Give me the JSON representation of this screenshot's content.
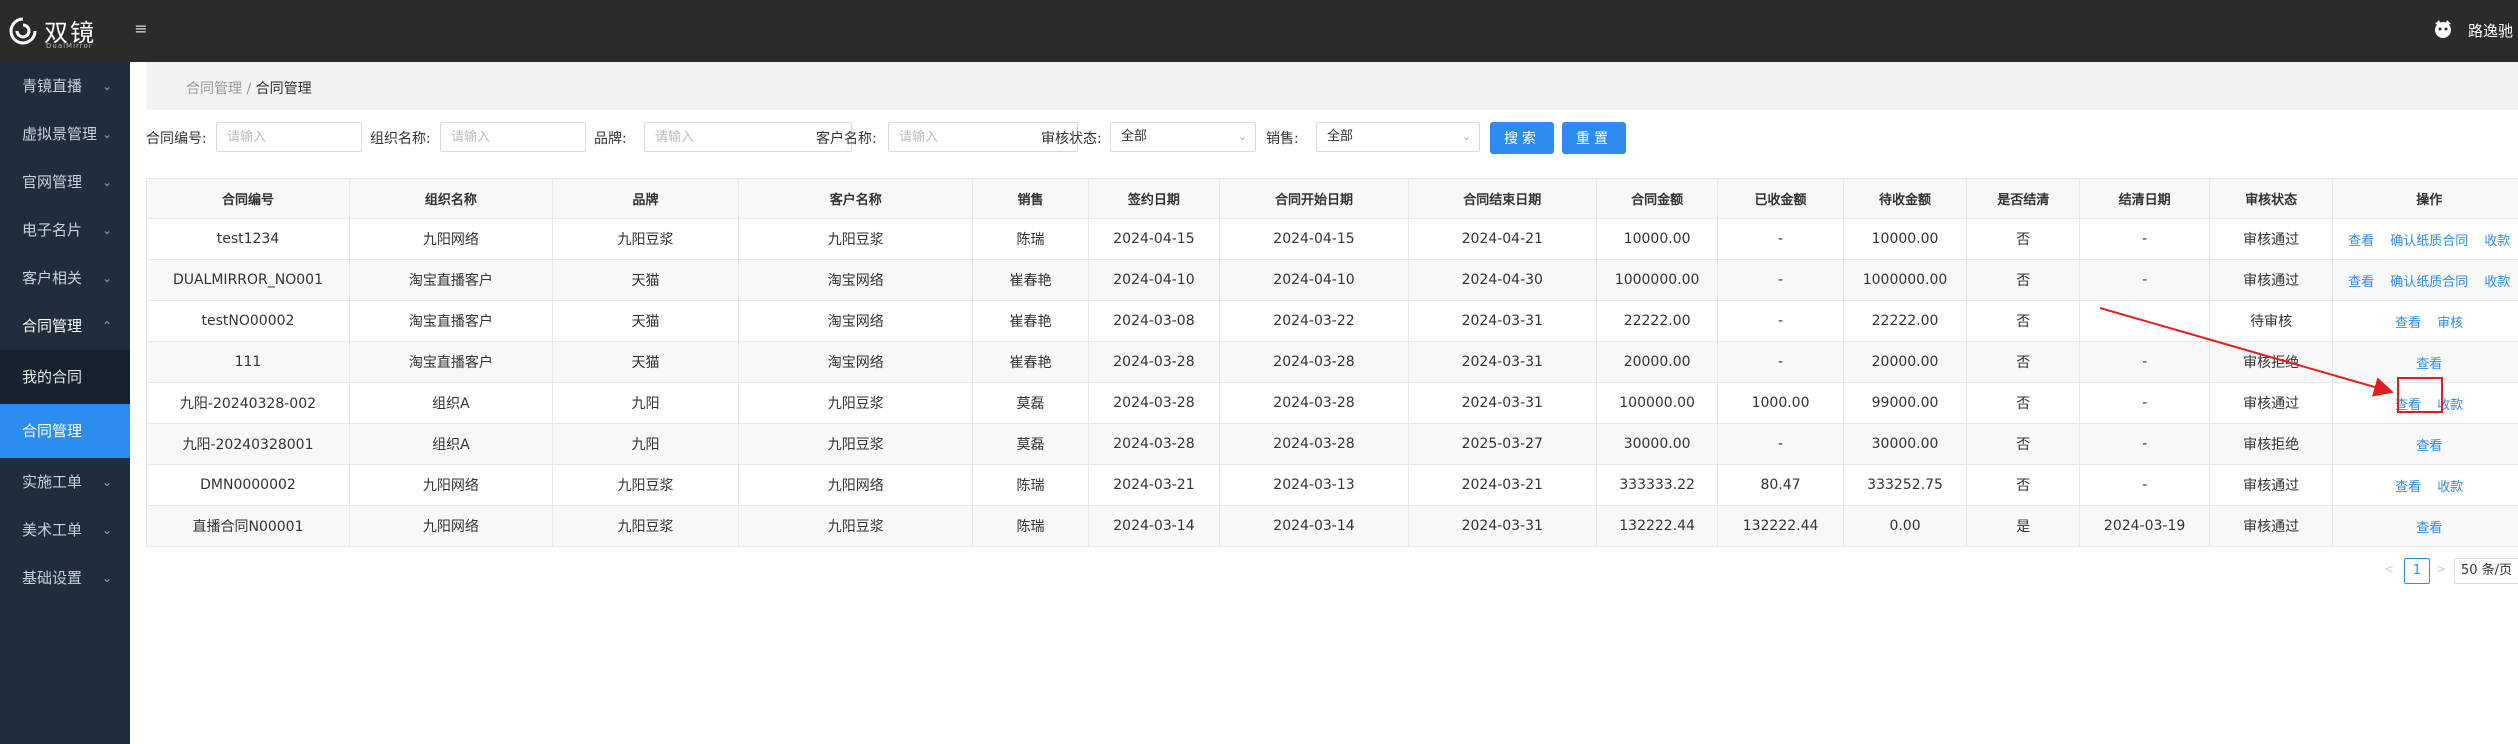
{
  "topbar": {
    "logo_text": "双镜",
    "logo_sub": "DualMirror",
    "user_name": "路逸驰"
  },
  "sidebar": {
    "items": [
      {
        "label": "青镜直播"
      },
      {
        "label": "虚拟景管理"
      },
      {
        "label": "官网管理"
      },
      {
        "label": "电子名片"
      },
      {
        "label": "客户相关"
      },
      {
        "label": "合同管理"
      },
      {
        "label": "实施工单"
      },
      {
        "label": "美术工单"
      },
      {
        "label": "基础设置"
      }
    ],
    "sub_items": [
      {
        "label": "我的合同"
      },
      {
        "label": "合同管理"
      }
    ]
  },
  "breadcrumb": {
    "parent": "合同管理",
    "sep": " / ",
    "current": "合同管理"
  },
  "filters": {
    "contract_no_label": "合同编号:",
    "org_name_label": "组织名称:",
    "brand_label": "品牌:",
    "customer_label": "客户名称:",
    "status_label": "审核状态:",
    "status_value": "全部",
    "sales_label": "销售:",
    "sales_value": "全部",
    "placeholder": "请输入",
    "search_label": "搜索",
    "reset_label": "重置"
  },
  "table": {
    "headers": [
      "合同编号",
      "组织名称",
      "品牌",
      "客户名称",
      "销售",
      "签约日期",
      "合同开始日期",
      "合同结束日期",
      "合同金额",
      "已收金额",
      "待收金额",
      "是否结清",
      "结清日期",
      "审核状态",
      "操作"
    ],
    "rows": [
      {
        "cells": [
          "test1234",
          "九阳网络",
          "九阳豆浆",
          "九阳豆浆",
          "陈瑞",
          "2024-04-15",
          "2024-04-15",
          "2024-04-21",
          "10000.00",
          "-",
          "10000.00",
          "否",
          "-",
          "审核通过"
        ],
        "ops": [
          "查看",
          "确认纸质合同",
          "收款"
        ]
      },
      {
        "cells": [
          "DUALMIRROR_NO001",
          "淘宝直播客户",
          "天猫",
          "淘宝网络",
          "崔春艳",
          "2024-04-10",
          "2024-04-10",
          "2024-04-30",
          "1000000.00",
          "-",
          "1000000.00",
          "否",
          "-",
          "审核通过"
        ],
        "ops": [
          "查看",
          "确认纸质合同",
          "收款"
        ]
      },
      {
        "cells": [
          "testNO00002",
          "淘宝直播客户",
          "天猫",
          "淘宝网络",
          "崔春艳",
          "2024-03-08",
          "2024-03-22",
          "2024-03-31",
          "22222.00",
          "-",
          "22222.00",
          "否",
          "-",
          "待审核"
        ],
        "ops": [
          "查看",
          "审核"
        ]
      },
      {
        "cells": [
          "111",
          "淘宝直播客户",
          "天猫",
          "淘宝网络",
          "崔春艳",
          "2024-03-28",
          "2024-03-28",
          "2024-03-31",
          "20000.00",
          "-",
          "20000.00",
          "否",
          "-",
          "审核拒绝"
        ],
        "ops": [
          "查看"
        ]
      },
      {
        "cells": [
          "九阳-20240328-002",
          "组织A",
          "九阳",
          "九阳豆浆",
          "莫磊",
          "2024-03-28",
          "2024-03-28",
          "2024-03-31",
          "100000.00",
          "1000.00",
          "99000.00",
          "否",
          "-",
          "审核通过"
        ],
        "ops": [
          "查看",
          "收款"
        ]
      },
      {
        "cells": [
          "九阳-20240328001",
          "组织A",
          "九阳",
          "九阳豆浆",
          "莫磊",
          "2024-03-28",
          "2024-03-28",
          "2025-03-27",
          "30000.00",
          "-",
          "30000.00",
          "否",
          "-",
          "审核拒绝"
        ],
        "ops": [
          "查看"
        ]
      },
      {
        "cells": [
          "DMN0000002",
          "九阳网络",
          "九阳豆浆",
          "九阳网络",
          "陈瑞",
          "2024-03-21",
          "2024-03-13",
          "2024-03-21",
          "333333.22",
          "80.47",
          "333252.75",
          "否",
          "-",
          "审核通过"
        ],
        "ops": [
          "查看",
          "收款"
        ]
      },
      {
        "cells": [
          "直播合同N00001",
          "九阳网络",
          "九阳豆浆",
          "九阳豆浆",
          "陈瑞",
          "2024-03-14",
          "2024-03-14",
          "2024-03-31",
          "132222.44",
          "132222.44",
          "0.00",
          "是",
          "2024-03-19",
          "审核通过"
        ],
        "ops": [
          "查看"
        ]
      }
    ]
  },
  "pagination": {
    "prev": "<",
    "current_page": "1",
    "next": ">",
    "page_size": "50 条/页"
  },
  "colors": {
    "accent": "#2d8cf0",
    "sidebar_bg": "#1f2d3d",
    "topbar_bg": "#2b2b2b",
    "annotation_red": "#e02020"
  },
  "icons": {
    "menu_toggle": "hamburger-icon",
    "avatar": "user-avatar-icon",
    "chevron": "chevron-icon",
    "select_arrow": "chevron-down-icon"
  }
}
